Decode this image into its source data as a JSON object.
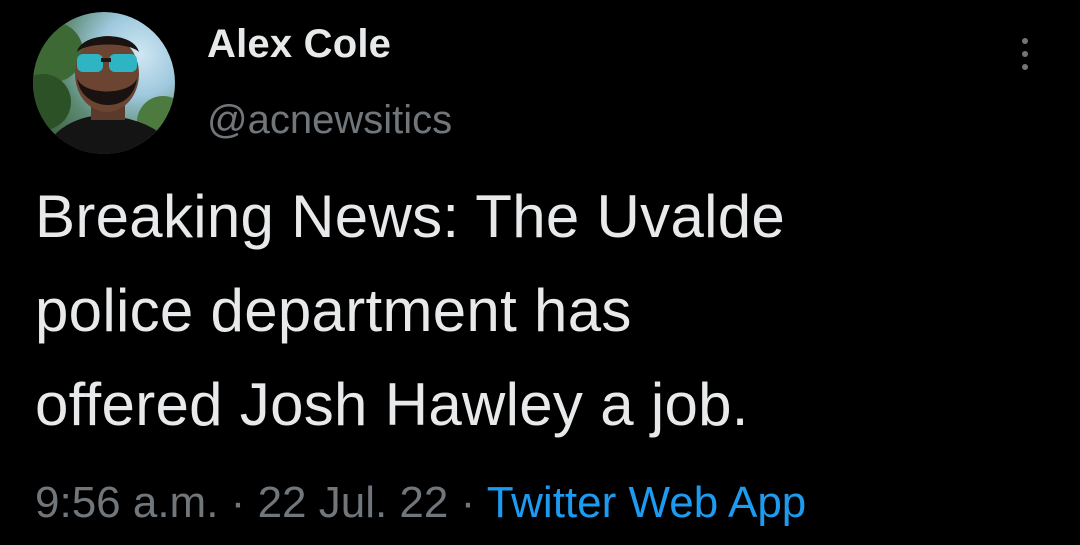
{
  "user": {
    "display_name": "Alex Cole",
    "handle": "@acnewsitics",
    "avatar_icon": "profile-photo"
  },
  "tweet": {
    "lines": [
      "Breaking News: The Uvalde",
      "police department has",
      "offered Josh Hawley a job."
    ]
  },
  "meta": {
    "time": "9:56 a.m.",
    "separator": "·",
    "date": "22 Jul. 22",
    "source": "Twitter Web App"
  },
  "colors": {
    "background": "#000000",
    "primary_text": "#e7e9ea",
    "secondary_text": "#71767b",
    "link": "#1d9bf0"
  },
  "icons": {
    "more": "more-vertical-icon"
  }
}
